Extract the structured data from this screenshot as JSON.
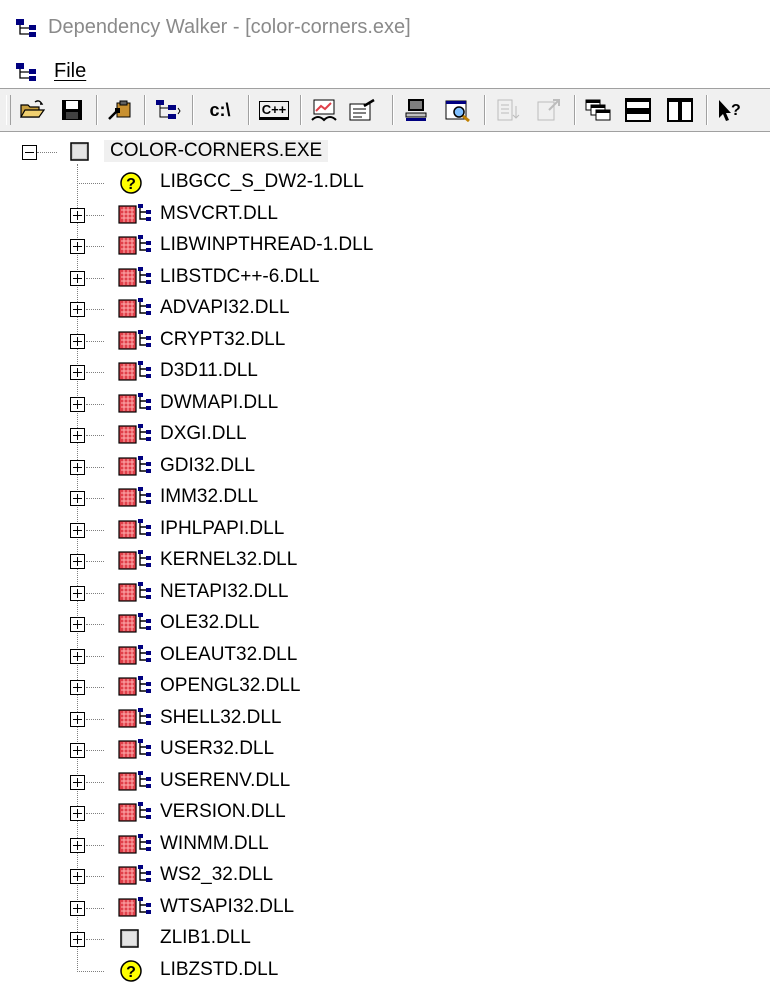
{
  "window": {
    "title": "Dependency Walker - [color-corners.exe]"
  },
  "menu": {
    "file_label": "File"
  },
  "toolbar": {
    "buttons": [
      {
        "name": "open-icon",
        "icon": "open-folder"
      },
      {
        "name": "save-icon",
        "icon": "floppy-disk"
      },
      {
        "name": "copy-icon",
        "icon": "clipboard"
      },
      {
        "name": "expand-all-icon",
        "icon": "tree-expand"
      },
      {
        "name": "full-paths-icon",
        "icon": "full-paths",
        "text": "c:\\"
      },
      {
        "name": "undecorate-cpp-icon",
        "icon": "undecorate",
        "text": "C++"
      },
      {
        "name": "profile-icon",
        "icon": "profile"
      },
      {
        "name": "properties-icon",
        "icon": "properties"
      },
      {
        "name": "system-info-icon",
        "icon": "system-info"
      },
      {
        "name": "view-module-icon",
        "icon": "view-module"
      },
      {
        "name": "sort-icon",
        "icon": "sort-disabled"
      },
      {
        "name": "external-viewer-icon",
        "icon": "external-disabled"
      },
      {
        "name": "cascade-icon",
        "icon": "cascade"
      },
      {
        "name": "tile-horizontal-icon",
        "icon": "tile-horizontal"
      },
      {
        "name": "tile-vertical-icon",
        "icon": "tile-vertical"
      },
      {
        "name": "help-icon",
        "icon": "context-help"
      }
    ]
  },
  "tree": {
    "root": {
      "label": "COLOR-CORNERS.EXE",
      "icon": "module-ok"
    },
    "children": [
      {
        "label": "LIBGCC_S_DW2-1.DLL",
        "icon": "missing",
        "expandable": false
      },
      {
        "label": "MSVCRT.DLL",
        "icon": "module-64bit",
        "expandable": true
      },
      {
        "label": "LIBWINPTHREAD-1.DLL",
        "icon": "module-64bit",
        "expandable": true
      },
      {
        "label": "LIBSTDC++-6.DLL",
        "icon": "module-64bit",
        "expandable": true
      },
      {
        "label": "ADVAPI32.DLL",
        "icon": "module-64bit",
        "expandable": true
      },
      {
        "label": "CRYPT32.DLL",
        "icon": "module-64bit",
        "expandable": true
      },
      {
        "label": "D3D11.DLL",
        "icon": "module-64bit",
        "expandable": true
      },
      {
        "label": "DWMAPI.DLL",
        "icon": "module-64bit",
        "expandable": true
      },
      {
        "label": "DXGI.DLL",
        "icon": "module-64bit",
        "expandable": true
      },
      {
        "label": "GDI32.DLL",
        "icon": "module-64bit",
        "expandable": true
      },
      {
        "label": "IMM32.DLL",
        "icon": "module-64bit",
        "expandable": true
      },
      {
        "label": "IPHLPAPI.DLL",
        "icon": "module-64bit",
        "expandable": true
      },
      {
        "label": "KERNEL32.DLL",
        "icon": "module-64bit",
        "expandable": true
      },
      {
        "label": "NETAPI32.DLL",
        "icon": "module-64bit",
        "expandable": true
      },
      {
        "label": "OLE32.DLL",
        "icon": "module-64bit",
        "expandable": true
      },
      {
        "label": "OLEAUT32.DLL",
        "icon": "module-64bit",
        "expandable": true
      },
      {
        "label": "OPENGL32.DLL",
        "icon": "module-64bit",
        "expandable": true
      },
      {
        "label": "SHELL32.DLL",
        "icon": "module-64bit",
        "expandable": true
      },
      {
        "label": "USER32.DLL",
        "icon": "module-64bit",
        "expandable": true
      },
      {
        "label": "USERENV.DLL",
        "icon": "module-64bit",
        "expandable": true
      },
      {
        "label": "VERSION.DLL",
        "icon": "module-64bit",
        "expandable": true
      },
      {
        "label": "WINMM.DLL",
        "icon": "module-64bit",
        "expandable": true
      },
      {
        "label": "WS2_32.DLL",
        "icon": "module-64bit",
        "expandable": true
      },
      {
        "label": "WTSAPI32.DLL",
        "icon": "module-64bit",
        "expandable": true
      },
      {
        "label": "ZLIB1.DLL",
        "icon": "module-ok",
        "expandable": true
      },
      {
        "label": "LIBZSTD.DLL",
        "icon": "missing",
        "expandable": false
      }
    ]
  },
  "colors": {
    "accent_red": "#e0404a",
    "help_yellow": "#ffff00",
    "navy": "#000080"
  }
}
